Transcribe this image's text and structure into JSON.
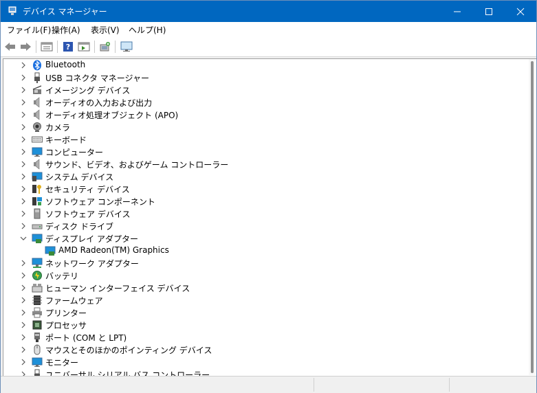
{
  "window": {
    "title": "デバイス マネージャー"
  },
  "menu": [
    "ファイル(F)",
    "操作(A)",
    "表示(V)",
    "ヘルプ(H)"
  ],
  "toolbar": [
    "back-icon",
    "forward-icon",
    "properties-view-icon",
    "help-icon",
    "run-view-icon",
    "scan-hardware-icon",
    "monitor-icon"
  ],
  "tree": [
    {
      "label": "Bluetooth",
      "icon": "bluetooth-icon",
      "expanded": false
    },
    {
      "label": "USB コネクタ マネージャー",
      "icon": "usb-icon",
      "expanded": false
    },
    {
      "label": "イメージング デバイス",
      "icon": "camera-device-icon",
      "expanded": false
    },
    {
      "label": "オーディオの入力および出力",
      "icon": "speaker-icon",
      "expanded": false
    },
    {
      "label": "オーディオ処理オブジェクト (APO)",
      "icon": "speaker-icon",
      "expanded": false
    },
    {
      "label": "カメラ",
      "icon": "webcam-icon",
      "expanded": false
    },
    {
      "label": "キーボード",
      "icon": "keyboard-icon",
      "expanded": false
    },
    {
      "label": "コンピューター",
      "icon": "computer-icon",
      "expanded": false
    },
    {
      "label": "サウンド、ビデオ、およびゲーム コントローラー",
      "icon": "speaker-icon",
      "expanded": false
    },
    {
      "label": "システム デバイス",
      "icon": "system-device-icon",
      "expanded": false
    },
    {
      "label": "セキュリティ デバイス",
      "icon": "security-key-icon",
      "expanded": false
    },
    {
      "label": "ソフトウェア コンポーネント",
      "icon": "software-component-icon",
      "expanded": false
    },
    {
      "label": "ソフトウェア デバイス",
      "icon": "software-device-icon",
      "expanded": false
    },
    {
      "label": "ディスク ドライブ",
      "icon": "disk-drive-icon",
      "expanded": false
    },
    {
      "label": "ディスプレイ アダプター",
      "icon": "display-adapter-icon",
      "expanded": true
    },
    {
      "label": "AMD Radeon(TM) Graphics",
      "icon": "display-adapter-icon",
      "child": true
    },
    {
      "label": "ネットワーク アダプター",
      "icon": "network-icon",
      "expanded": false
    },
    {
      "label": "バッテリ",
      "icon": "battery-icon",
      "expanded": false
    },
    {
      "label": "ヒューマン インターフェイス デバイス",
      "icon": "hid-icon",
      "expanded": false
    },
    {
      "label": "ファームウェア",
      "icon": "firmware-icon",
      "expanded": false
    },
    {
      "label": "プリンター",
      "icon": "printer-icon",
      "expanded": false
    },
    {
      "label": "プロセッサ",
      "icon": "processor-icon",
      "expanded": false
    },
    {
      "label": "ポート (COM と LPT)",
      "icon": "port-icon",
      "expanded": false
    },
    {
      "label": "マウスとそのほかのポインティング デバイス",
      "icon": "mouse-icon",
      "expanded": false
    },
    {
      "label": "モニター",
      "icon": "monitor-icon",
      "expanded": false
    },
    {
      "label": "ユニバーサル シリアル バス コントローラー",
      "icon": "usb-icon",
      "expanded": false
    }
  ],
  "colors": {
    "titlebar": "#0067c0",
    "selection": "#cce8ff"
  }
}
